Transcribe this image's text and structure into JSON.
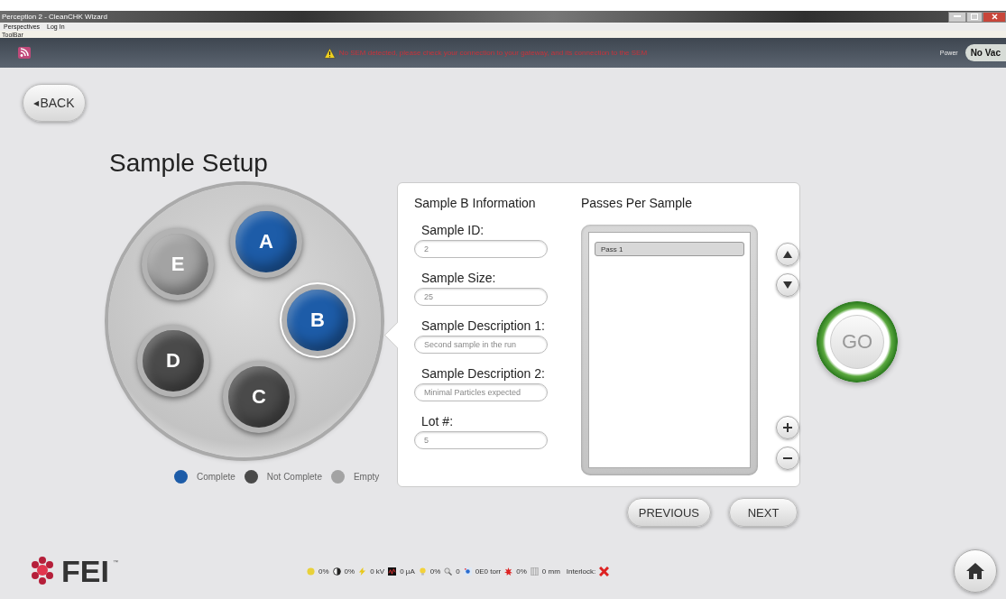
{
  "window": {
    "title": "Perception 2 - CleanCHK Wizard"
  },
  "menu": [
    "Perspectives",
    "Log In"
  ],
  "toolbar": {
    "label": "ToolBar"
  },
  "alert": {
    "message": "No SEM detected, please check your connection to your gateway, and its connection to the SEM",
    "power_label": "Power",
    "vacuum": "No Vac"
  },
  "back_button": {
    "arrow": "◀",
    "label": "BACK"
  },
  "title": "Sample Setup",
  "samples": [
    {
      "label": "A",
      "color": "#1d5ca8",
      "selected": false
    },
    {
      "label": "B",
      "color": "#1d5ca8",
      "selected": true
    },
    {
      "label": "C",
      "color": "#4a4a4a",
      "selected": false
    },
    {
      "label": "D",
      "color": "#4a4a4a",
      "selected": false
    },
    {
      "label": "E",
      "color": "#a3a3a3",
      "selected": false
    }
  ],
  "legend": [
    {
      "label": "Complete",
      "color": "#1d5ca8"
    },
    {
      "label": "Not Complete",
      "color": "#4a4a4a"
    },
    {
      "label": "Empty",
      "color": "#a3a3a3"
    }
  ],
  "info": {
    "heading": "Sample B Information",
    "fields": [
      {
        "label": "Sample ID:",
        "value": "2"
      },
      {
        "label": "Sample Size:",
        "value": "25"
      },
      {
        "label": "Sample Description 1:",
        "value": "Second sample in the run"
      },
      {
        "label": "Sample Description 2:",
        "value": "Minimal Particles expected"
      },
      {
        "label": "Lot #:",
        "value": "5"
      }
    ]
  },
  "passes": {
    "heading": "Passes Per Sample",
    "items": [
      {
        "label": "Pass 1",
        "selected": true
      }
    ]
  },
  "go_button": {
    "label": "GO"
  },
  "nav_buttons": [
    "PREVIOUS",
    "NEXT"
  ],
  "status_bar": {
    "items": [
      {
        "kind": "sun",
        "text": "0%"
      },
      {
        "kind": "contrast",
        "text": "0%"
      },
      {
        "kind": "bolt",
        "text": "0 kV"
      },
      {
        "kind": "current",
        "text": "0 µA"
      },
      {
        "kind": "bulb",
        "text": "0%"
      },
      {
        "kind": "magnifier",
        "text": "0"
      },
      {
        "kind": "vacuum",
        "text": "0E0 torr"
      },
      {
        "kind": "laser",
        "text": "0%"
      },
      {
        "kind": "gauge",
        "text": "0 mm"
      }
    ],
    "interlock": {
      "label": "Interlock:",
      "ok": false
    }
  },
  "logo": {
    "text": "FEI",
    "mark": "™"
  }
}
